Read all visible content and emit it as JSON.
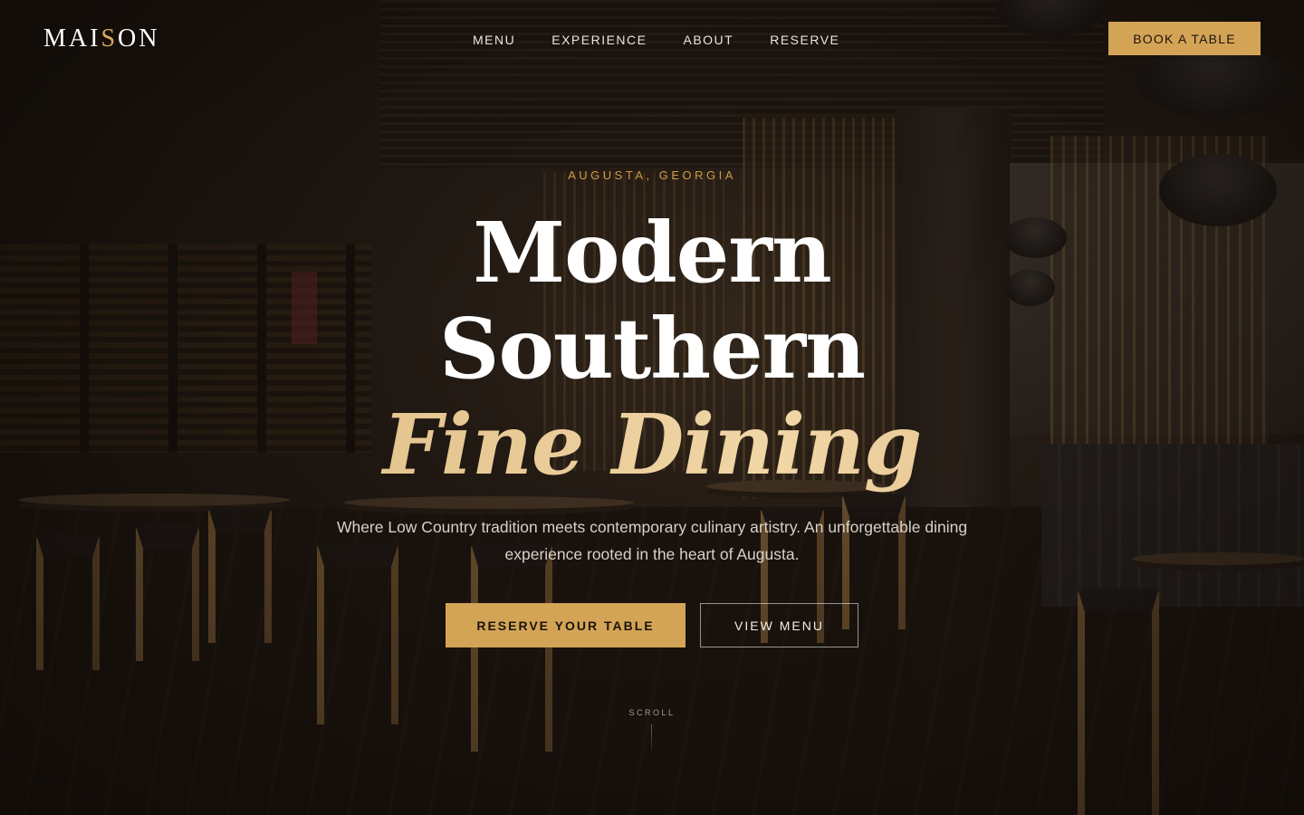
{
  "brand": {
    "logo_part1": "MAI",
    "logo_accent": "S",
    "logo_part2": "ON"
  },
  "nav": {
    "items": [
      {
        "label": "MENU"
      },
      {
        "label": "EXPERIENCE"
      },
      {
        "label": "ABOUT"
      },
      {
        "label": "RESERVE"
      }
    ],
    "cta_label": "BOOK A TABLE"
  },
  "hero": {
    "eyebrow": "AUGUSTA, GEORGIA",
    "headline_line1": "Modern",
    "headline_line2": "Southern",
    "headline_line3": "Fine Dining",
    "subtitle": "Where Low Country tradition meets contemporary culinary artistry. An unforgettable dining experience rooted in the heart of Augusta.",
    "primary_cta": "RESERVE YOUR TABLE",
    "secondary_cta": "VIEW MENU",
    "scroll_label": "SCROLL"
  },
  "colors": {
    "accent": "#d4a456",
    "headline_accent": "#e6c48c",
    "eyebrow": "#d09a4c",
    "background": "#1a130e"
  }
}
